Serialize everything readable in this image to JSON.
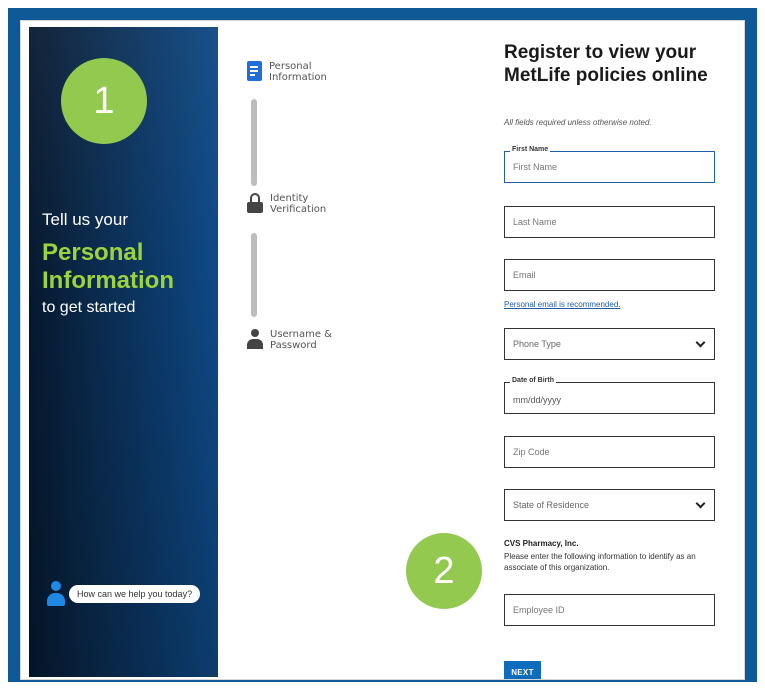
{
  "hero": {
    "line1": "Tell us your",
    "highlight_line1": "Personal",
    "highlight_line2": "Information",
    "line3": "to get started"
  },
  "chat": {
    "text": "How can we help you today?"
  },
  "steps": [
    {
      "line1": "Personal",
      "line2": "Information",
      "icon": "document-icon"
    },
    {
      "line1": "Identity",
      "line2": "Verification",
      "icon": "lock-icon"
    },
    {
      "line1": "Username &",
      "line2": "Password",
      "icon": "user-icon"
    }
  ],
  "form": {
    "title_line1": "Register to view your",
    "title_line2": "MetLife policies online",
    "required_note": "All fields required unless otherwise noted.",
    "first_name": {
      "label": "First Name",
      "placeholder": "First Name"
    },
    "last_name": {
      "placeholder": "Last Name"
    },
    "email": {
      "placeholder": "Email"
    },
    "email_helper": "Personal email is recommended.",
    "phone_type": {
      "value": "Phone Type"
    },
    "dob": {
      "label": "Date of Birth",
      "value": "mm/dd/yyyy"
    },
    "zip": {
      "placeholder": "Zip Code"
    },
    "state": {
      "value": "State of Residence"
    },
    "org_title": "CVS Pharmacy, Inc.",
    "org_desc": "Please enter the following information to identify as an associate of this organization.",
    "employee_id": {
      "placeholder": "Employee ID"
    },
    "next_label": "NEXT"
  },
  "badges": [
    "1",
    "2"
  ],
  "colors": {
    "frame": "#0f5a96",
    "accent_green": "#9cd23c",
    "badge_green": "#94c94f",
    "primary_blue": "#0f6cbd"
  }
}
